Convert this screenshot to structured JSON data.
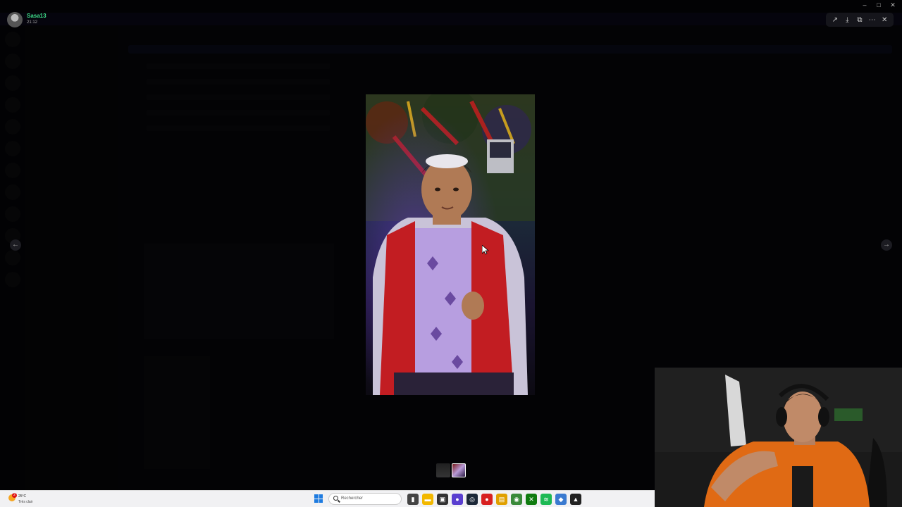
{
  "viewer": {
    "uploader_name": "Sasa13",
    "timestamp": "21:12"
  },
  "taskbar": {
    "weather_temp": "25°C",
    "weather_desc": "Très clair",
    "notification_count": "2",
    "search_placeholder": "Rechercher"
  },
  "icons": {
    "toolbar": [
      "forward-icon",
      "download-icon",
      "open-external-icon",
      "more-icon",
      "close-icon"
    ],
    "taskbar_apps": [
      "task-view-icon",
      "file-explorer-icon",
      "store-icon",
      "browser-icon",
      "steam-icon",
      "app-red-icon",
      "notes-icon",
      "chrome-icon",
      "xbox-icon",
      "spotify-icon",
      "app-multicolor-icon",
      "terminal-icon"
    ]
  },
  "colors": {
    "username": "#3fe08a",
    "accent": "#5865f2"
  }
}
